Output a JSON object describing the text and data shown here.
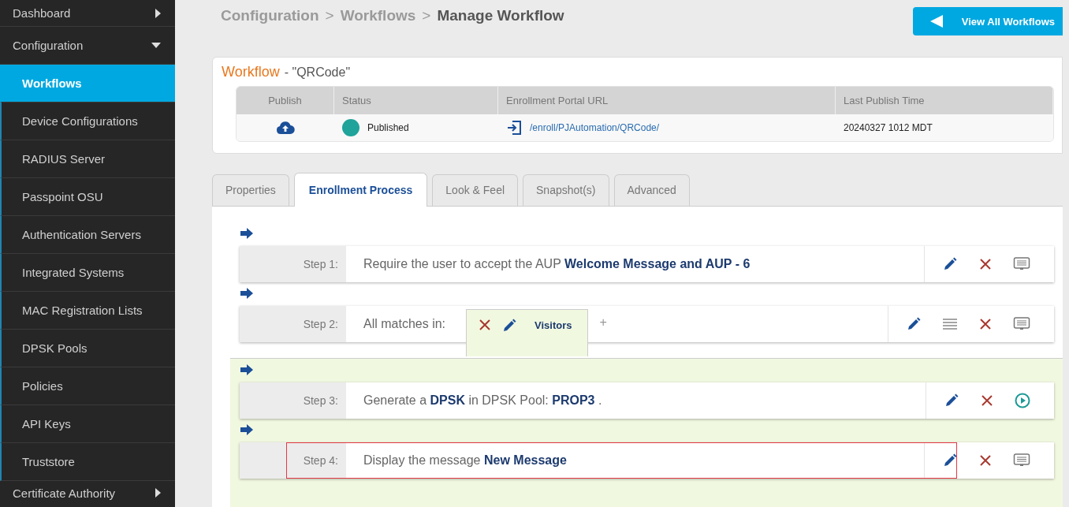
{
  "sidebar": {
    "items": [
      {
        "label": "Dashboard",
        "expanded": false
      },
      {
        "label": "Configuration",
        "expanded": true,
        "children": [
          {
            "label": "Workflows",
            "selected": true
          },
          {
            "label": "Device Configurations",
            "selected": false
          },
          {
            "label": "RADIUS Server",
            "selected": false
          },
          {
            "label": "Passpoint OSU",
            "selected": false
          },
          {
            "label": "Authentication Servers",
            "selected": false
          },
          {
            "label": "Integrated Systems",
            "selected": false
          },
          {
            "label": "MAC Registration Lists",
            "selected": false
          },
          {
            "label": "DPSK Pools",
            "selected": false
          },
          {
            "label": "Policies",
            "selected": false
          },
          {
            "label": "API Keys",
            "selected": false
          },
          {
            "label": "Truststore",
            "selected": false
          }
        ]
      },
      {
        "label": "Certificate Authority",
        "expanded": false
      }
    ]
  },
  "breadcrumb": [
    {
      "label": "Configuration",
      "current": false
    },
    {
      "label": ">",
      "current": false
    },
    {
      "label": "Workflows",
      "current": false
    },
    {
      "label": ">",
      "current": false
    },
    {
      "label": "Manage Workflow",
      "current": true
    }
  ],
  "header_button": {
    "label": "View All Workflows"
  },
  "workflow": {
    "title": "Workflow",
    "name": "- \"QRCode\"",
    "table": {
      "columns": [
        "Publish",
        "Status",
        "Enrollment Portal URL",
        "Last Publish Time"
      ],
      "row": {
        "status": "Published",
        "url": "/enroll/PJAutomation/QRCode/",
        "last_publish_time": "20240327 1012 MDT"
      }
    }
  },
  "tabs": [
    {
      "label": "Properties",
      "selected": false
    },
    {
      "label": "Enrollment Process",
      "selected": true
    },
    {
      "label": "Look & Feel",
      "selected": false
    },
    {
      "label": "Snapshot(s)",
      "selected": false
    },
    {
      "label": "Advanced",
      "selected": false
    }
  ],
  "steps": [
    {
      "label": "Step 1:",
      "text": "Require the user to accept the AUP **Welcome Message and AUP - 6**",
      "highlighted": false,
      "actions": [
        {
          "kind": "edit"
        },
        {
          "kind": "delete"
        },
        {
          "kind": "message"
        }
      ]
    },
    {
      "label": "Step 2:",
      "text": "All matches in:",
      "highlighted": false,
      "actions": [
        {
          "kind": "edit"
        },
        {
          "kind": "reorder"
        },
        {
          "kind": "delete"
        },
        {
          "kind": "message"
        }
      ],
      "add_label": "+",
      "branches": [
        {
          "label": "Visitors",
          "selected": true,
          "steps": [
            {
              "label": "Step 3:",
              "text": "Generate a **DPSK** in DPSK Pool: **PROP3** .",
              "highlighted": false,
              "actions": [
                {
                  "kind": "edit"
                },
                {
                  "kind": "delete"
                },
                {
                  "kind": "play"
                }
              ]
            },
            {
              "label": "Step 4:",
              "text": "Display the message **New Message**",
              "highlighted": true,
              "actions": [
                {
                  "kind": "edit"
                },
                {
                  "kind": "delete"
                },
                {
                  "kind": "message"
                }
              ]
            }
          ]
        }
      ]
    }
  ]
}
